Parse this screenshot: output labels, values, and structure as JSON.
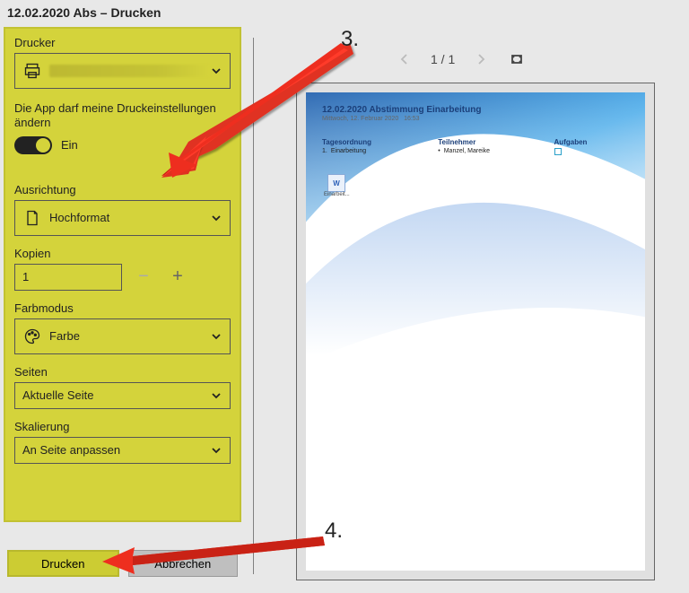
{
  "window": {
    "title": "12.02.2020 Abs – Drucken"
  },
  "panel": {
    "printer_label": "Drucker",
    "printer_value_redacted": true,
    "app_permission_text": "Die App darf meine Druckeinstellungen ändern",
    "toggle_label": "Ein",
    "orientation_label": "Ausrichtung",
    "orientation_value": "Hochformat",
    "copies_label": "Kopien",
    "copies_value": "1",
    "colormode_label": "Farbmodus",
    "colormode_value": "Farbe",
    "pages_label": "Seiten",
    "pages_value": "Aktuelle Seite",
    "scaling_label": "Skalierung",
    "scaling_value": "An Seite anpassen"
  },
  "buttons": {
    "print": "Drucken",
    "cancel": "Abbrechen"
  },
  "preview_nav": {
    "page_indicator": "1 / 1"
  },
  "document": {
    "title": "12.02.2020 Abstimmung Einarbeitung",
    "subtitle_date": "Mittwoch, 12. Februar 2020",
    "subtitle_time": "16:53",
    "col_agenda_h": "Tagesordnung",
    "col_agenda_item": "Einarbeitung",
    "col_participants_h": "Teilnehmer",
    "col_participants_item": "Manzel, Mareike",
    "col_tasks_h": "Aufgaben",
    "file_label": "Einarbeit..."
  },
  "annotations": {
    "step3": "3.",
    "step4": "4."
  }
}
